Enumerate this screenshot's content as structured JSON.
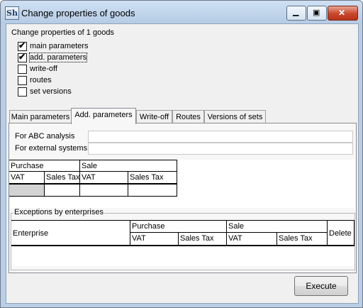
{
  "window": {
    "title": "Change properties of goods",
    "icon_text": "Sh",
    "min_glyph": "▁",
    "max_glyph": "▣",
    "close_glyph": "✕"
  },
  "header": {
    "summary": "Change properties of 1 goods"
  },
  "options": [
    {
      "label": "main parameters",
      "checked": true
    },
    {
      "label": "add. parameters",
      "checked": true
    },
    {
      "label": "write-off",
      "checked": false
    },
    {
      "label": "routes",
      "checked": false
    },
    {
      "label": "set versions",
      "checked": false
    }
  ],
  "check_glyph": "✔",
  "tabs": [
    "Main parameters",
    "Add. parameters",
    "Write-off",
    "Routes",
    "Versions of sets"
  ],
  "add_params": {
    "fields": [
      {
        "label": "For ABC analysis",
        "value": ""
      },
      {
        "label": "For external systems",
        "value": ""
      }
    ]
  },
  "tax_table": {
    "groups": [
      "Purchase",
      "Sale"
    ],
    "columns": [
      "VAT",
      "Sales Tax",
      "VAT",
      "Sales Tax"
    ]
  },
  "exceptions": {
    "title": "Exceptions by enterprises",
    "enterprise_col": "Enterprise",
    "groups": [
      "Purchase",
      "Sale"
    ],
    "columns": [
      "VAT",
      "Sales Tax",
      "VAT",
      "Sales Tax"
    ],
    "delete_col": "Delete"
  },
  "footer": {
    "execute_label": "Execute"
  }
}
